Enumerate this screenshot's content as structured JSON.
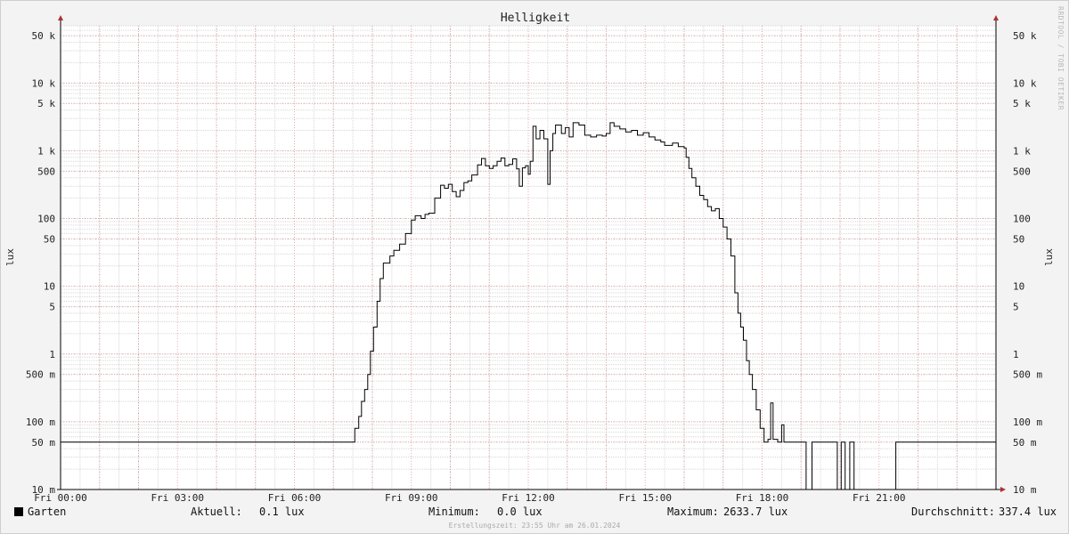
{
  "chart_data": {
    "type": "line",
    "title": "Helligkeit",
    "ylabel": "lux",
    "yscale": "log",
    "ylim": [
      0.01,
      70000
    ],
    "xlim": [
      0,
      24
    ],
    "x_ticks": [
      {
        "v": 0,
        "label": "Fri 00:00"
      },
      {
        "v": 3,
        "label": "Fri 03:00"
      },
      {
        "v": 6,
        "label": "Fri 06:00"
      },
      {
        "v": 9,
        "label": "Fri 09:00"
      },
      {
        "v": 12,
        "label": "Fri 12:00"
      },
      {
        "v": 15,
        "label": "Fri 15:00"
      },
      {
        "v": 18,
        "label": "Fri 18:00"
      },
      {
        "v": 21,
        "label": "Fri 21:00"
      }
    ],
    "y_ticks": [
      {
        "v": 50000,
        "label": "50 k"
      },
      {
        "v": 10000,
        "label": "10 k"
      },
      {
        "v": 5000,
        "label": "5 k"
      },
      {
        "v": 1000,
        "label": "1 k"
      },
      {
        "v": 500,
        "label": "500"
      },
      {
        "v": 100,
        "label": "100"
      },
      {
        "v": 50,
        "label": "50"
      },
      {
        "v": 10,
        "label": "10"
      },
      {
        "v": 5,
        "label": "5"
      },
      {
        "v": 1,
        "label": "1"
      },
      {
        "v": 0.5,
        "label": "500 m"
      },
      {
        "v": 0.1,
        "label": "100 m"
      },
      {
        "v": 0.05,
        "label": "50 m"
      },
      {
        "v": 0.01,
        "label": "10 m"
      }
    ],
    "series": [
      {
        "name": "Garten",
        "color": "#000000",
        "points": [
          [
            0,
            0.05
          ],
          [
            7.5,
            0.05
          ],
          [
            7.55,
            0.08
          ],
          [
            7.65,
            0.12
          ],
          [
            7.72,
            0.2
          ],
          [
            7.8,
            0.3
          ],
          [
            7.88,
            0.5
          ],
          [
            7.95,
            1.1
          ],
          [
            8.03,
            2.5
          ],
          [
            8.12,
            6
          ],
          [
            8.2,
            13
          ],
          [
            8.28,
            22
          ],
          [
            8.45,
            28
          ],
          [
            8.55,
            34
          ],
          [
            8.7,
            42
          ],
          [
            8.85,
            60
          ],
          [
            9.0,
            95
          ],
          [
            9.1,
            110
          ],
          [
            9.25,
            100
          ],
          [
            9.35,
            115
          ],
          [
            9.45,
            120
          ],
          [
            9.6,
            200
          ],
          [
            9.75,
            310
          ],
          [
            9.85,
            280
          ],
          [
            9.95,
            320
          ],
          [
            10.05,
            250
          ],
          [
            10.15,
            210
          ],
          [
            10.25,
            260
          ],
          [
            10.35,
            340
          ],
          [
            10.45,
            360
          ],
          [
            10.55,
            440
          ],
          [
            10.7,
            620
          ],
          [
            10.8,
            770
          ],
          [
            10.9,
            600
          ],
          [
            11.0,
            550
          ],
          [
            11.1,
            600
          ],
          [
            11.2,
            700
          ],
          [
            11.3,
            780
          ],
          [
            11.4,
            600
          ],
          [
            11.5,
            630
          ],
          [
            11.6,
            760
          ],
          [
            11.7,
            540
          ],
          [
            11.77,
            300
          ],
          [
            11.85,
            560
          ],
          [
            11.93,
            600
          ],
          [
            12.0,
            450
          ],
          [
            12.05,
            700
          ],
          [
            12.12,
            2300
          ],
          [
            12.2,
            1500
          ],
          [
            12.3,
            2000
          ],
          [
            12.4,
            1500
          ],
          [
            12.5,
            320
          ],
          [
            12.56,
            1000
          ],
          [
            12.63,
            1800
          ],
          [
            12.7,
            2400
          ],
          [
            12.85,
            1800
          ],
          [
            12.95,
            2200
          ],
          [
            13.05,
            1600
          ],
          [
            13.15,
            2600
          ],
          [
            13.3,
            2400
          ],
          [
            13.45,
            1700
          ],
          [
            13.6,
            1600
          ],
          [
            13.75,
            1700
          ],
          [
            13.9,
            1650
          ],
          [
            14.0,
            1800
          ],
          [
            14.1,
            2600
          ],
          [
            14.2,
            2300
          ],
          [
            14.35,
            2100
          ],
          [
            14.5,
            1900
          ],
          [
            14.65,
            2000
          ],
          [
            14.8,
            1700
          ],
          [
            14.95,
            1850
          ],
          [
            15.1,
            1600
          ],
          [
            15.25,
            1450
          ],
          [
            15.4,
            1350
          ],
          [
            15.5,
            1200
          ],
          [
            15.7,
            1300
          ],
          [
            15.85,
            1150
          ],
          [
            16.0,
            1100
          ],
          [
            16.05,
            800
          ],
          [
            16.12,
            550
          ],
          [
            16.2,
            400
          ],
          [
            16.3,
            300
          ],
          [
            16.4,
            220
          ],
          [
            16.5,
            190
          ],
          [
            16.6,
            150
          ],
          [
            16.7,
            130
          ],
          [
            16.8,
            140
          ],
          [
            16.9,
            100
          ],
          [
            17.0,
            75
          ],
          [
            17.1,
            50
          ],
          [
            17.2,
            28
          ],
          [
            17.3,
            8
          ],
          [
            17.38,
            4
          ],
          [
            17.45,
            2.5
          ],
          [
            17.52,
            1.6
          ],
          [
            17.6,
            0.8
          ],
          [
            17.67,
            0.5
          ],
          [
            17.75,
            0.3
          ],
          [
            17.85,
            0.15
          ],
          [
            17.95,
            0.08
          ],
          [
            18.05,
            0.05
          ],
          [
            18.15,
            0.055
          ],
          [
            18.22,
            0.19
          ],
          [
            18.28,
            0.055
          ],
          [
            18.4,
            0.05
          ],
          [
            18.5,
            0.09
          ],
          [
            18.56,
            0.05
          ],
          [
            19.1,
            0.05
          ],
          [
            19.13,
            0.01
          ],
          [
            19.25,
            0.01
          ],
          [
            19.28,
            0.05
          ],
          [
            19.9,
            0.05
          ],
          [
            19.93,
            0.01
          ],
          [
            20.0,
            0.01
          ],
          [
            20.03,
            0.05
          ],
          [
            20.1,
            0.05
          ],
          [
            20.13,
            0.01
          ],
          [
            20.22,
            0.01
          ],
          [
            20.25,
            0.05
          ],
          [
            20.33,
            0.05
          ],
          [
            20.36,
            0.01
          ],
          [
            21.4,
            0.01
          ],
          [
            21.43,
            0.05
          ],
          [
            24,
            0.05
          ]
        ]
      }
    ],
    "grid": true
  },
  "legend": {
    "series_name": "Garten",
    "current_label": "Aktuell:",
    "current_value": "0.1 lux",
    "min_label": "Minimum:",
    "min_value": "0.0 lux",
    "max_label": "Maximum:",
    "max_value": "2633.7 lux",
    "avg_label": "Durchschnitt:",
    "avg_value": "337.4 lux"
  },
  "footer": "Erstellungszeit: 23:55 Uhr am 26.01.2024",
  "watermark": "RRDTOOL / TOBI OETIKER",
  "colors": {
    "minor_grid": "#d6d6d6",
    "major_grid": "#e7a7a7",
    "axis": "#000000",
    "arrow": "#b03030",
    "plot_bg": "#ffffff"
  }
}
